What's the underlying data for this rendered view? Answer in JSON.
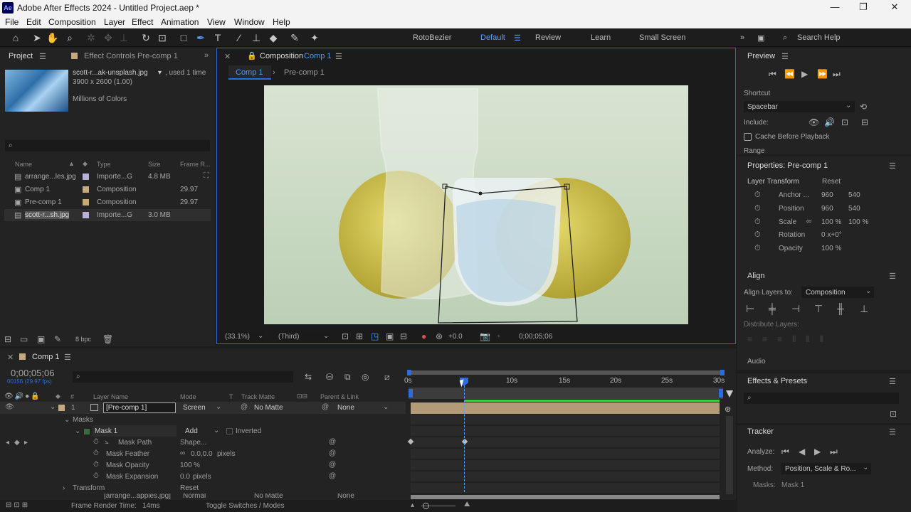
{
  "window": {
    "title": "Adobe After Effects 2024 - Untitled Project.aep *",
    "app_icon": "Ae"
  },
  "menu": [
    "File",
    "Edit",
    "Composition",
    "Layer",
    "Effect",
    "Animation",
    "View",
    "Window",
    "Help"
  ],
  "toolbar": {
    "rotobezier": "RotoBezier",
    "workspaces": [
      "Default",
      "Review",
      "Learn",
      "Small Screen"
    ],
    "search": "Search Help"
  },
  "project": {
    "tab": "Project",
    "effect_controls_tab": "Effect Controls Pre-comp 1",
    "footage_name": "scott-r...ak-unsplash.jpg",
    "footage_used": ", used 1 time",
    "footage_dims": "3900 x 2600 (1.00)",
    "footage_colors": "Millions of Colors",
    "columns": [
      "Name",
      "Type",
      "Size",
      "Frame R..."
    ],
    "items": [
      {
        "name": "arrange...les.jpg",
        "type": "Importe...G",
        "size": "4.8 MB",
        "rate": "",
        "color": "#b9b1d6"
      },
      {
        "name": "Comp 1",
        "type": "Composition",
        "size": "",
        "rate": "29.97",
        "color": "#c6a97c"
      },
      {
        "name": "Pre-comp 1",
        "type": "Composition",
        "size": "",
        "rate": "29.97",
        "color": "#c6a97c"
      },
      {
        "name": "scott-r...sh.jpg",
        "type": "Importe...G",
        "size": "3.0 MB",
        "rate": "",
        "color": "#b9b1d6"
      }
    ],
    "bpc": "8 bpc"
  },
  "composition": {
    "tab_prefix": "Composition",
    "tab_name": "Comp 1",
    "crumbs": [
      "Comp 1",
      "Pre-comp 1"
    ],
    "zoom": "(33.1%)",
    "resolution": "(Third)",
    "exposure": "+0.0",
    "timecode": "0;00;05;06"
  },
  "preview": {
    "title": "Preview",
    "shortcut_label": "Shortcut",
    "shortcut_value": "Spacebar",
    "include": "Include:",
    "cache": "Cache Before Playback",
    "range": "Range"
  },
  "properties": {
    "title": "Properties: Pre-comp 1",
    "layer_transform": "Layer Transform",
    "reset": "Reset",
    "rows": [
      {
        "label": "Anchor ...",
        "v1": "960",
        "v2": "540"
      },
      {
        "label": "Position",
        "v1": "960",
        "v2": "540"
      },
      {
        "label": "Scale",
        "v1": "100 %",
        "v2": "100 %"
      },
      {
        "label": "Rotation",
        "v1": "0 x+0°",
        "v2": ""
      },
      {
        "label": "Opacity",
        "v1": "100 %",
        "v2": ""
      }
    ]
  },
  "align": {
    "title": "Align",
    "align_to_label": "Align Layers to:",
    "align_to_value": "Composition",
    "distribute": "Distribute Layers:",
    "audio": "Audio"
  },
  "effects": {
    "title": "Effects & Presets"
  },
  "tracker": {
    "title": "Tracker",
    "analyze": "Analyze:",
    "method_label": "Method:",
    "method_value": "Position, Scale & Ro...",
    "masks_label": "Masks:",
    "masks_value": "Mask 1"
  },
  "timeline": {
    "tab": "Comp 1",
    "timecode": "0;00;05;06",
    "fps": "00156 (29.97 fps)",
    "columns": {
      "layer_name": "Layer Name",
      "mode": "Mode",
      "t": "T",
      "track_matte": "Track Matte",
      "parent": "Parent & Link"
    },
    "layer": {
      "num": "1",
      "name": "[Pre-comp 1]",
      "mode": "Screen",
      "matte": "No Matte",
      "parent": "None"
    },
    "masks": "Masks",
    "mask1": "Mask 1",
    "mask_mode": "Add",
    "inverted": "Inverted",
    "mask_path": "Mask Path",
    "mask_path_val": "Shape...",
    "mask_feather": "Mask Feather",
    "mask_feather_val": "0.0,0.0",
    "pixels": "pixels",
    "mask_opacity": "Mask Opacity",
    "mask_opacity_val": "100",
    "pct": "%",
    "mask_expansion": "Mask Expansion",
    "mask_expansion_val": "0.0",
    "transform": "Transform",
    "reset": "Reset",
    "layer2_name": "[arrange...apples.jpg]",
    "layer2_mode": "Normal",
    "layer2_matte": "No Matte",
    "layer2_parent": "None",
    "render_time_label": "Frame Render Time:",
    "render_time": "14ms",
    "toggle": "Toggle Switches / Modes",
    "ruler": [
      "0s",
      "10s",
      "15s",
      "20s",
      "25s",
      "30s"
    ]
  }
}
